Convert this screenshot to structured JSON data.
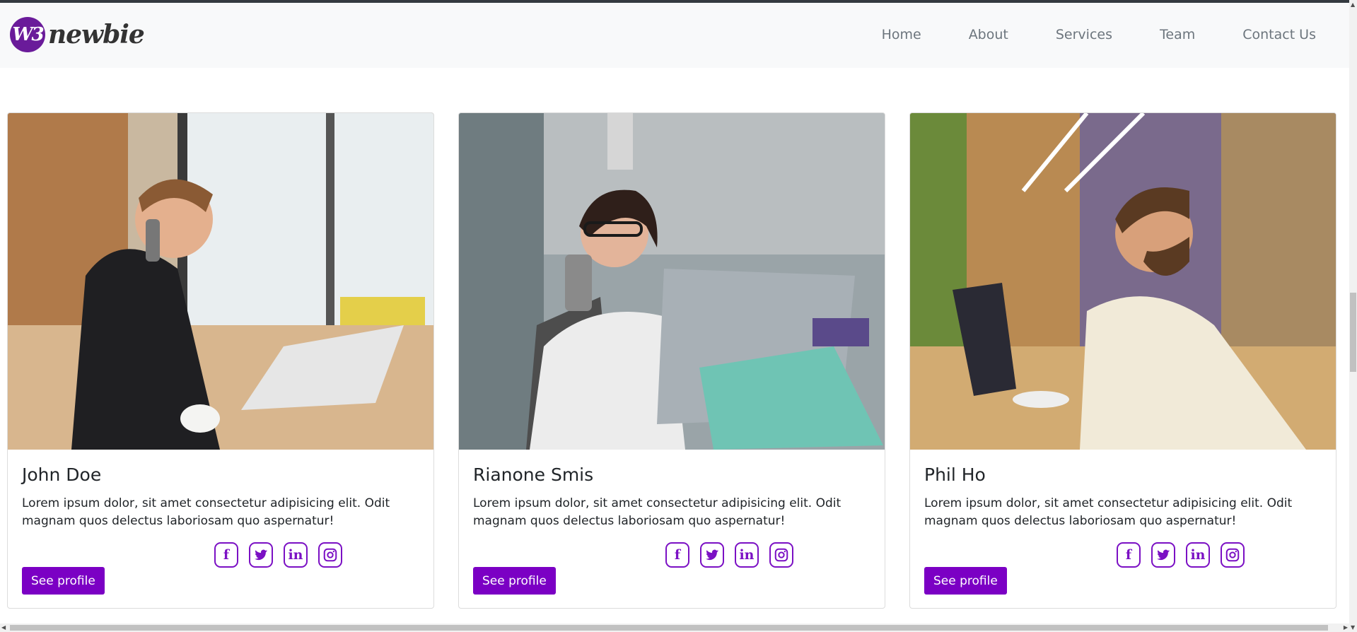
{
  "brand": {
    "mark": "W3",
    "name": "newbie"
  },
  "nav": {
    "items": [
      {
        "label": "Home"
      },
      {
        "label": "About"
      },
      {
        "label": "Services"
      },
      {
        "label": "Team"
      },
      {
        "label": "Contact Us"
      }
    ]
  },
  "team": [
    {
      "name": "John Doe",
      "bio": "Lorem ipsum dolor, sit amet consectetur adipisicing elit. Odit magnam quos delectus laboriosam quo aspernatur!",
      "button": "See profile"
    },
    {
      "name": "Rianone Smis",
      "bio": "Lorem ipsum dolor, sit amet consectetur adipisicing elit. Odit magnam quos delectus laboriosam quo aspernatur!",
      "button": "See profile"
    },
    {
      "name": "Phil Ho",
      "bio": "Lorem ipsum dolor, sit amet consectetur adipisicing elit. Odit magnam quos delectus laboriosam quo aspernatur!",
      "button": "See profile"
    }
  ],
  "socials": [
    "facebook-icon",
    "twitter-icon",
    "linkedin-icon",
    "instagram-icon"
  ],
  "colors": {
    "accent": "#7b00c4",
    "navbar_bg": "#f8f9fa",
    "nav_text": "#6c757d"
  }
}
